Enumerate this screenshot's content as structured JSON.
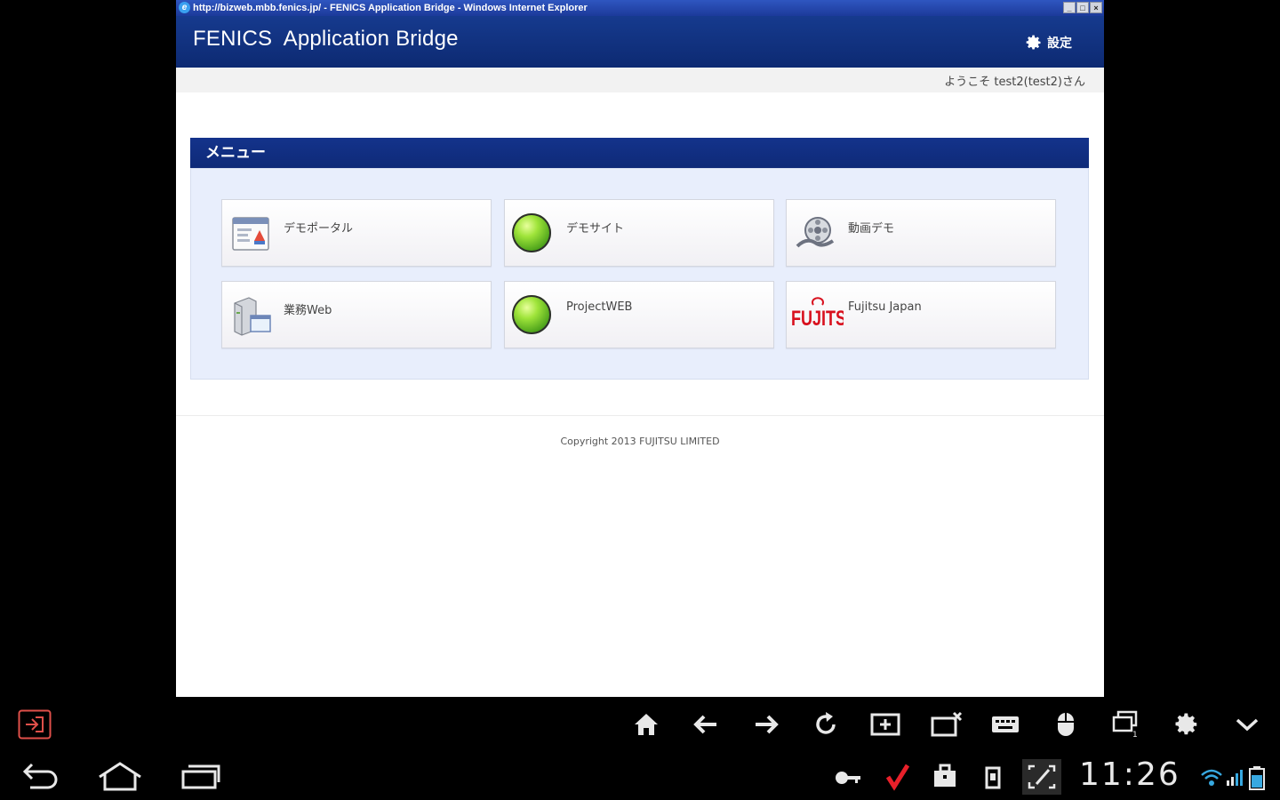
{
  "browser": {
    "title": "http://bizweb.mbb.fenics.jp/ - FENICS Application Bridge - Windows Internet Explorer",
    "window_buttons": [
      "_",
      "□",
      "×"
    ]
  },
  "header": {
    "app_title": "FENICS  Application Bridge",
    "settings_label": "設定"
  },
  "welcome": "ようこそ test2(test2)さん",
  "menu": {
    "title": "メニュー",
    "items": [
      {
        "label": "デモポータル",
        "icon": "portal-window-icon"
      },
      {
        "label": "デモサイト",
        "icon": "green-circle-icon"
      },
      {
        "label": "動画デモ",
        "icon": "film-reel-icon"
      },
      {
        "label": "業務Web",
        "icon": "server-monitor-icon"
      },
      {
        "label": "ProjectWEB",
        "icon": "green-circle-icon"
      },
      {
        "label": "Fujitsu Japan",
        "icon": "fujitsu-logo"
      }
    ]
  },
  "footer": {
    "copyright": "Copyright 2013 FUJITSU LIMITED"
  },
  "toolbar": {
    "icons": [
      "exit-icon",
      "home-icon",
      "back-arrow-icon",
      "forward-arrow-icon",
      "reload-icon",
      "add-window-icon",
      "close-window-icon",
      "keyboard-icon",
      "mouse-icon",
      "windows-icon",
      "gear-icon",
      "chevron-down-icon"
    ]
  },
  "system_bar": {
    "clock": "11:26",
    "nav_icons": [
      "back-icon",
      "home-icon",
      "recent-apps-icon"
    ],
    "status_icons": [
      "key-icon",
      "check-icon",
      "briefcase-icon",
      "sd-card-icon",
      "screenshot-icon",
      "wifi-icon",
      "signal-icon",
      "battery-icon"
    ]
  },
  "colors": {
    "header": "#0d2a72",
    "menu_bar": "#0e2a78",
    "panel": "#e8eefc",
    "exit_icon": "#e0504a",
    "check": "#e8202a"
  }
}
